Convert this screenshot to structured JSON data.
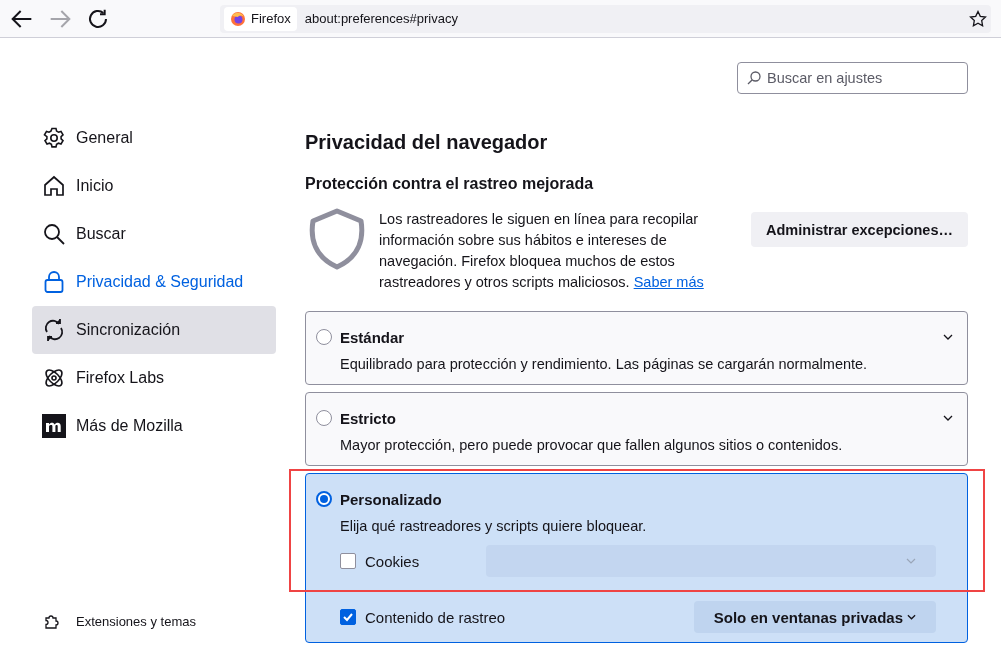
{
  "toolbar": {
    "forward_disabled": true,
    "identity_label": "Firefox",
    "url": "about:preferences#privacy"
  },
  "search": {
    "placeholder": "Buscar en ajustes"
  },
  "sidebar": {
    "items": [
      {
        "label": "General",
        "kind": "gear",
        "selected": false,
        "hovered": false
      },
      {
        "label": "Inicio",
        "kind": "home",
        "selected": false,
        "hovered": false
      },
      {
        "label": "Buscar",
        "kind": "search",
        "selected": false,
        "hovered": false
      },
      {
        "label": "Privacidad & Seguridad",
        "kind": "lock",
        "selected": true,
        "hovered": false
      },
      {
        "label": "Sincronización",
        "kind": "sync",
        "selected": false,
        "hovered": true
      },
      {
        "label": "Firefox Labs",
        "kind": "atom",
        "selected": false,
        "hovered": false
      },
      {
        "label": "Más de Mozilla",
        "kind": "m",
        "selected": false,
        "hovered": false
      }
    ],
    "footer": [
      {
        "label": "Extensiones y temas",
        "kind": "puzzle"
      }
    ]
  },
  "main": {
    "title": "Privacidad del navegador",
    "section_title": "Protección contra el rastreo mejorada",
    "description": "Los rastreadores le siguen en línea para recopilar información sobre sus hábitos e intereses de navegación. Firefox bloquea muchos de estos rastreadores y otros scripts maliciosos.",
    "learn_more": "Saber más",
    "exceptions_button": "Administrar excepciones…",
    "options": [
      {
        "kind": "plain",
        "label": "Estándar",
        "description": "Equilibrado para protección y rendimiento. Las páginas se cargarán normalmente.",
        "selected": false
      },
      {
        "kind": "plain",
        "label": "Estricto",
        "description": "Mayor protección, pero puede provocar que fallen algunos sitios o contenidos.",
        "selected": false
      },
      {
        "kind": "custom",
        "label": "Personalizado",
        "description": "Elija qué rastreadores y scripts quiere bloquear.",
        "selected": true,
        "settings": [
          {
            "label": "Cookies",
            "checked": false,
            "dropdown": {
              "disabled": true
            }
          },
          {
            "label": "Contenido de rastreo",
            "checked": true,
            "dropdown": {
              "value": "Solo en ventanas privadas",
              "disabled": false
            }
          }
        ]
      }
    ]
  },
  "highlight": {
    "color": "#ef4444"
  }
}
